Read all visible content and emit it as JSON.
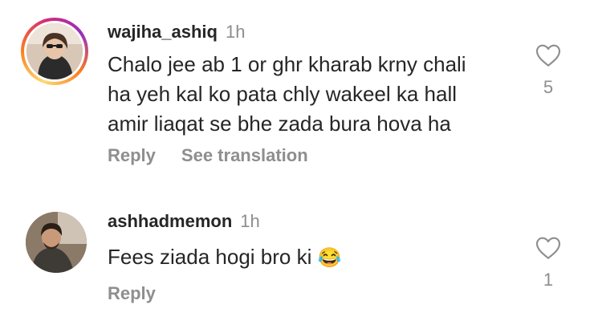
{
  "comments": [
    {
      "username": "wajiha_ashiq",
      "time": "1h",
      "text_lines": [
        "Chalo jee ab 1 or ghr kharab krny chali",
        "ha yeh kal ko pata chly wakeel ka hall",
        "amir liaqat se bhe zada bura hova ha"
      ],
      "like_count": "5",
      "actions": [
        "Reply",
        "See translation"
      ],
      "avatar_story_ring": true
    },
    {
      "username": "ashhadmemon",
      "time": "1h",
      "text": "Fees ziada hogi bro ki",
      "emoji": "😂",
      "like_count": "1",
      "actions": [
        "Reply"
      ]
    }
  ],
  "icons": {
    "like": "heart-outline-icon"
  },
  "colors": {
    "text": "#262626",
    "secondary": "#8e8e8e",
    "background": "#ffffff"
  }
}
